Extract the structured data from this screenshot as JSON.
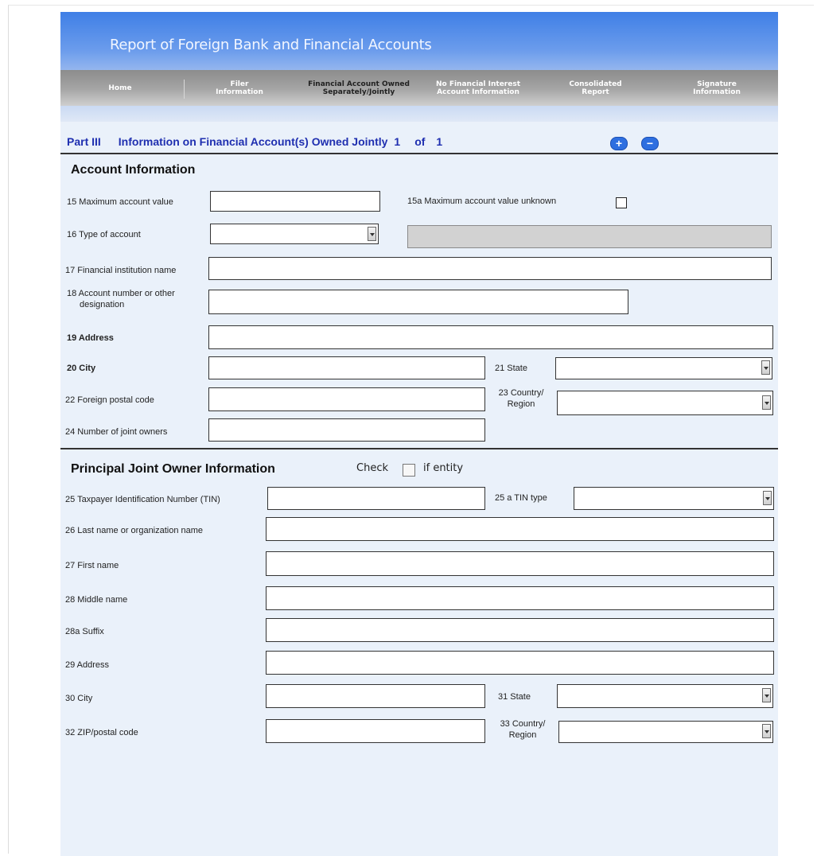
{
  "header": {
    "title": "Report of Foreign Bank and Financial Accounts",
    "tabs": [
      {
        "line1": "Home",
        "line2": ""
      },
      {
        "line1": "Filer",
        "line2": "Information"
      },
      {
        "line1": "Financial Account Owned",
        "line2": "Separately/Jointly"
      },
      {
        "line1": "No Financial Interest",
        "line2": "Account Information"
      },
      {
        "line1": "Consolidated",
        "line2": "Report"
      },
      {
        "line1": "Signature",
        "line2": "Information"
      }
    ]
  },
  "part": {
    "label": "Part III",
    "title": "Information on Financial Account(s) Owned Jointly",
    "current": "1",
    "of_label": "of",
    "total": "1",
    "add_symbol": "+",
    "remove_symbol": "−"
  },
  "account": {
    "heading": "Account Information",
    "f15": "15 Maximum account value",
    "f15a": "15a Maximum account value unknown",
    "f16": "16 Type of account",
    "f17": "17 Financial institution name",
    "f18a": "18 Account number or other",
    "f18b": "designation",
    "f19": "19  Address",
    "f20": "20  City",
    "f21": "21 State",
    "f22": "22 Foreign postal code",
    "f23a": "23 Country/",
    "f23b": "Region",
    "f24": "24 Number of joint owners"
  },
  "owner": {
    "heading": "Principal Joint Owner Information",
    "check_label": "Check",
    "entity_label": "if entity",
    "f25": "25 Taxpayer Identification Number (TIN)",
    "f25a": "25 a TIN type",
    "f26": "26  Last name  or organization name",
    "f27": "27  First name",
    "f28": "28  Middle name",
    "f28a": "28a Suffix",
    "f29": "29  Address",
    "f30": "30  City",
    "f31": "31 State",
    "f32": "32 ZIP/postal code",
    "f33a": "33 Country/",
    "f33b": "Region"
  }
}
